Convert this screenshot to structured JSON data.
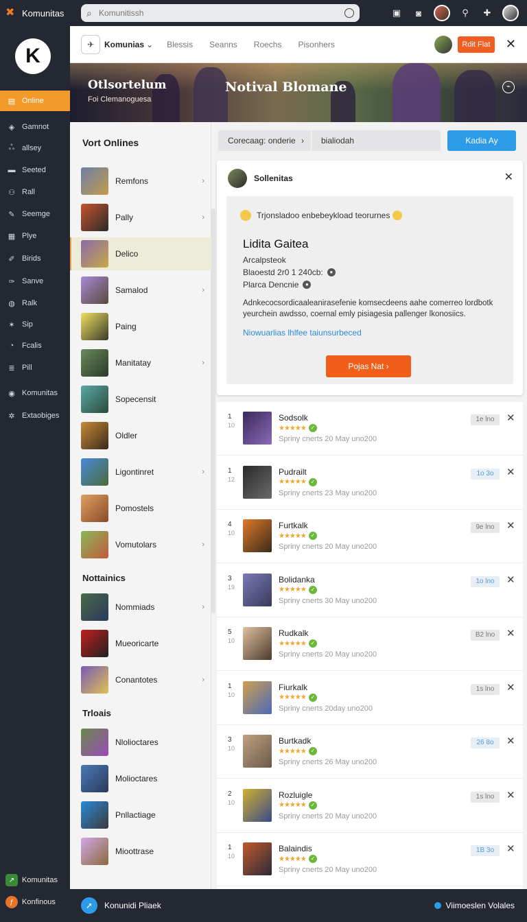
{
  "topbar": {
    "brand": "Komunitas",
    "search_value": "Komunitissh"
  },
  "sidebar": {
    "items": [
      {
        "label": "Online",
        "icon": "folder-icon",
        "active": true
      },
      {
        "label": "Gamnot",
        "icon": "tag-icon"
      },
      {
        "label": "allsey",
        "icon": "people-icon"
      },
      {
        "label": "Seeted",
        "icon": "card-icon"
      },
      {
        "label": "Rall",
        "icon": "group-icon"
      },
      {
        "label": "Seemge",
        "icon": "brush-icon"
      },
      {
        "label": "Plye",
        "icon": "grid-icon"
      },
      {
        "label": "Birids",
        "icon": "pen-icon"
      },
      {
        "label": "Sanve",
        "icon": "feather-icon"
      },
      {
        "label": "Ralk",
        "icon": "chat-icon"
      },
      {
        "label": "Sip",
        "icon": "star-icon"
      },
      {
        "label": "Fcalis",
        "icon": "clock-icon"
      },
      {
        "label": "Pill",
        "icon": "list-icon"
      },
      {
        "label": "Komunitas",
        "icon": "compass-icon"
      },
      {
        "label": "Extaobiges",
        "icon": "gear-icon"
      }
    ],
    "bottom": [
      {
        "label": "Komunitas",
        "icon": "app-green-icon"
      },
      {
        "label": "Konfinous",
        "icon": "app-orange-icon"
      }
    ]
  },
  "header": {
    "app_name": "Komunias",
    "tabs": [
      "Blessis",
      "Seanns",
      "Roechs",
      "Pisonhers"
    ],
    "action_label": "Rdit Flat"
  },
  "banner": {
    "title_left": "Otlsortelum",
    "subtitle_left": "Foi Clemanoguesa",
    "title_center": "Notival Blomane"
  },
  "list": {
    "title": "Vort Onlines",
    "sections": [
      {
        "title": "",
        "items": [
          {
            "label": "Remfons",
            "arrow": true
          },
          {
            "label": "Pally",
            "arrow": true
          },
          {
            "label": "Delico",
            "arrow": false,
            "selected": true
          },
          {
            "label": "Samalod",
            "arrow": true
          },
          {
            "label": "Paing",
            "arrow": false
          },
          {
            "label": "Manitatay",
            "arrow": true
          },
          {
            "label": "Sopecensit",
            "arrow": false
          },
          {
            "label": "Oldler",
            "arrow": false
          },
          {
            "label": "Ligontinret",
            "arrow": true
          },
          {
            "label": "Pomostels",
            "arrow": false
          },
          {
            "label": "Vomutolars",
            "arrow": true
          }
        ]
      },
      {
        "title": "Nottainics",
        "items": [
          {
            "label": "Nommiads",
            "arrow": true
          },
          {
            "label": "Mueoricarte",
            "arrow": false
          },
          {
            "label": "Conantotes",
            "arrow": true
          }
        ]
      },
      {
        "title": "Trloais",
        "items": [
          {
            "label": "Nlolioctares",
            "arrow": false
          },
          {
            "label": "Molioctares",
            "arrow": false
          },
          {
            "label": "Pnllactiage",
            "arrow": false
          },
          {
            "label": "Mioottrase",
            "arrow": false
          }
        ]
      }
    ]
  },
  "filter": {
    "dropdown_label": "Corecaag: onderie",
    "input_value": "bialiodah",
    "button_label": "Kadia Ay"
  },
  "card": {
    "title": "Sollenitas",
    "note": "Trjonsladoo enbebeykload teorurnes",
    "user_name": "Lidita Gaitea",
    "subtitle": "Arcalpsteok",
    "line1": "Blaoestd 2r0 1 240cb:",
    "line2": "Plarca Dencnie",
    "description": "Adnkecocsordicaaleanirasefenie komsecdeens aahe comerreo lordbotk yeurchein awdsso, coernal emly pisiagesia pallenger lkonosiics.",
    "link": "Niowuarlias lhlfee taiunsurbeced",
    "button_label": "Pojas Nat"
  },
  "feed": [
    {
      "rank": "1",
      "sub": "10",
      "name": "Sodsolk",
      "meta": "Spriny cnerts 20 May uno200",
      "badge": "1e lno",
      "blue": false
    },
    {
      "rank": "1",
      "sub": "12",
      "name": "Pudrailt",
      "meta": "Spriny cnerts 23 May uno200",
      "badge": "1o 3o",
      "blue": true
    },
    {
      "rank": "4",
      "sub": "10",
      "name": "Furtkalk",
      "meta": "Spriny cnerts 20 May uno200",
      "badge": "9e lno",
      "blue": false
    },
    {
      "rank": "3",
      "sub": "19",
      "name": "Bolidanka",
      "meta": "Spriny cnerts 30 May uno200",
      "badge": "1o lno",
      "blue": true
    },
    {
      "rank": "5",
      "sub": "10",
      "name": "Rudkalk",
      "meta": "Spriny cnerts 20 May uno200",
      "badge": "B2 lno",
      "blue": false
    },
    {
      "rank": "1",
      "sub": "10",
      "name": "Fiurkalk",
      "meta": "Spriny cnerts 20day uno200",
      "badge": "1s lno",
      "blue": false
    },
    {
      "rank": "3",
      "sub": "10",
      "name": "Burtkadk",
      "meta": "Spriny cnerts 26 May uno200",
      "badge": "26 8o",
      "blue": true
    },
    {
      "rank": "2",
      "sub": "10",
      "name": "Rozluigle",
      "meta": "Spriny cnerts 20 May uno200",
      "badge": "1s lno",
      "blue": false
    },
    {
      "rank": "1",
      "sub": "10",
      "name": "Balaindis",
      "meta": "Spriny cnerts 20 May uno200",
      "badge": "1B 3o",
      "blue": true
    }
  ],
  "bottombar": {
    "left_label": "Konunidi Pliaek",
    "right_label": "Viimoeslen Volales"
  },
  "colors": {
    "accent_orange": "#f29b2a",
    "button_orange": "#f05e1a",
    "accent_blue": "#2e9be8",
    "sidebar_bg": "#232833"
  }
}
